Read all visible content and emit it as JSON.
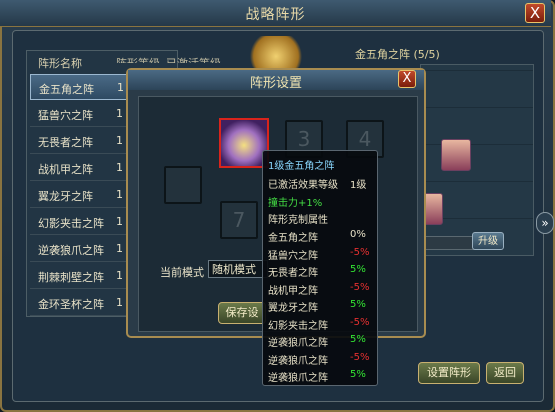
{
  "main": {
    "title": "战略阵形",
    "close_glyph": "X"
  },
  "list": {
    "headers": {
      "name": "阵形名称",
      "level": "阵形等级",
      "activated": "已激活等级"
    },
    "rows": [
      {
        "name": "金五角之阵",
        "level": "1",
        "selected": true
      },
      {
        "name": "猛兽穴之阵",
        "level": "1",
        "selected": false
      },
      {
        "name": "无畏者之阵",
        "level": "1",
        "selected": false
      },
      {
        "name": "战机甲之阵",
        "level": "1",
        "selected": false
      },
      {
        "name": "翼龙牙之阵",
        "level": "1",
        "selected": false
      },
      {
        "name": "幻影夹击之阵",
        "level": "1",
        "selected": false
      },
      {
        "name": "逆袭狼爪之阵",
        "level": "1",
        "selected": false
      },
      {
        "name": "荆棘刺壁之阵",
        "level": "1",
        "selected": false
      },
      {
        "name": "金环圣杯之阵",
        "level": "1",
        "selected": false
      }
    ]
  },
  "right_panel": {
    "title": "金五角之阵 (5/5)",
    "upgrade_label": "升级",
    "side_arrow": "»"
  },
  "buttons": {
    "set_formation": "设置阵形",
    "back": "返回"
  },
  "dialog": {
    "title": "阵形设置",
    "close_glyph": "X",
    "mode_label": "当前模式",
    "mode_value": "随机模式",
    "save_label": "保存设",
    "slot_numbers": [
      "3",
      "4",
      "7"
    ]
  },
  "tooltip": {
    "title": "1级金五角之阵",
    "level_label": "已激活效果等级",
    "level_value": "1级",
    "attack_bonus": "撞击力+1%",
    "counter_title": "阵形克制属性",
    "counters": [
      {
        "name": "金五角之阵",
        "value": "0%",
        "type": "neutral"
      },
      {
        "name": "猛兽穴之阵",
        "value": "-5%",
        "type": "neg"
      },
      {
        "name": "无畏者之阵",
        "value": "5%",
        "type": "pos"
      },
      {
        "name": "战机甲之阵",
        "value": "-5%",
        "type": "neg"
      },
      {
        "name": "翼龙牙之阵",
        "value": "5%",
        "type": "pos"
      },
      {
        "name": "幻影夹击之阵",
        "value": "-5%",
        "type": "neg"
      },
      {
        "name": "逆袭狼爪之阵",
        "value": "5%",
        "type": "pos"
      },
      {
        "name": "逆袭狼爪之阵",
        "value": "-5%",
        "type": "neg"
      },
      {
        "name": "逆袭狼爪之阵",
        "value": "5%",
        "type": "pos"
      }
    ]
  },
  "colors": {
    "positive": "#33e533",
    "negative": "#e53030",
    "neutral": "#e8e2c8",
    "title_cyan": "#8ad8ff",
    "bonus_green": "#44dd44"
  }
}
